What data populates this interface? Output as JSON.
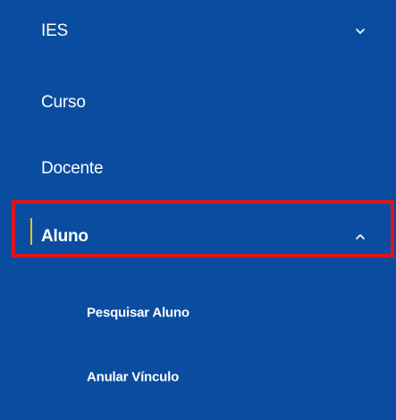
{
  "colors": {
    "sidebar_bg": "#0a4da0",
    "text": "#ffffff",
    "highlight_border": "#e0141e",
    "active_indicator": "#f2c21b"
  },
  "menu": {
    "items": [
      {
        "label": "IES",
        "chevron": "chevron-down-icon"
      },
      {
        "label": "Curso"
      },
      {
        "label": "Docente"
      },
      {
        "label": "Aluno",
        "chevron": "chevron-up-icon",
        "expanded": true
      }
    ],
    "aluno_submenu": [
      {
        "label": "Pesquisar Aluno"
      },
      {
        "label": "Anular Vínculo"
      }
    ]
  }
}
